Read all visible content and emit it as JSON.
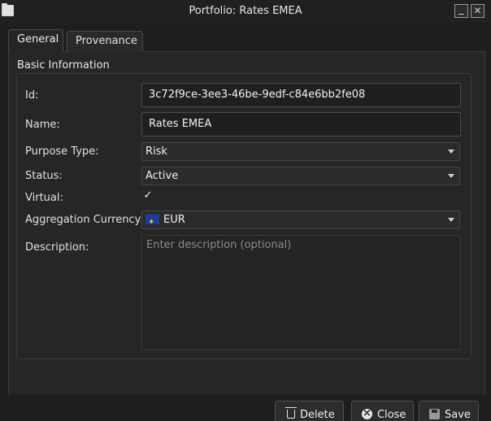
{
  "window": {
    "title": "Portfolio: Rates EMEA",
    "app_icon": "folder-icon",
    "minimize_icon": "minimize-icon",
    "close_icon": "close-icon"
  },
  "tabs": [
    {
      "label": "General",
      "active": true
    },
    {
      "label": "Provenance",
      "active": false
    }
  ],
  "group": {
    "title": "Basic Information"
  },
  "form": {
    "id": {
      "label": "Id:",
      "value": "3c72f9ce-3ee3-46be-9edf-c84e6bb2fe08"
    },
    "name": {
      "label": "Name:",
      "value": "Rates EMEA"
    },
    "purpose_type": {
      "label": "Purpose Type:",
      "value": "Risk"
    },
    "status": {
      "label": "Status:",
      "value": "Active"
    },
    "virtual": {
      "label": "Virtual:",
      "checked": true,
      "check_glyph": "✓"
    },
    "aggregation_currency": {
      "label": "Aggregation Currency:",
      "value": "EUR",
      "icon": "eu-flag-icon"
    },
    "description": {
      "label": "Description:",
      "value": "",
      "placeholder": "Enter description (optional)"
    }
  },
  "buttons": {
    "delete": {
      "label": "Delete",
      "icon": "trash-icon"
    },
    "close": {
      "label": "Close",
      "icon": "close-circle-icon"
    },
    "save": {
      "label": "Save",
      "icon": "save-icon"
    }
  }
}
